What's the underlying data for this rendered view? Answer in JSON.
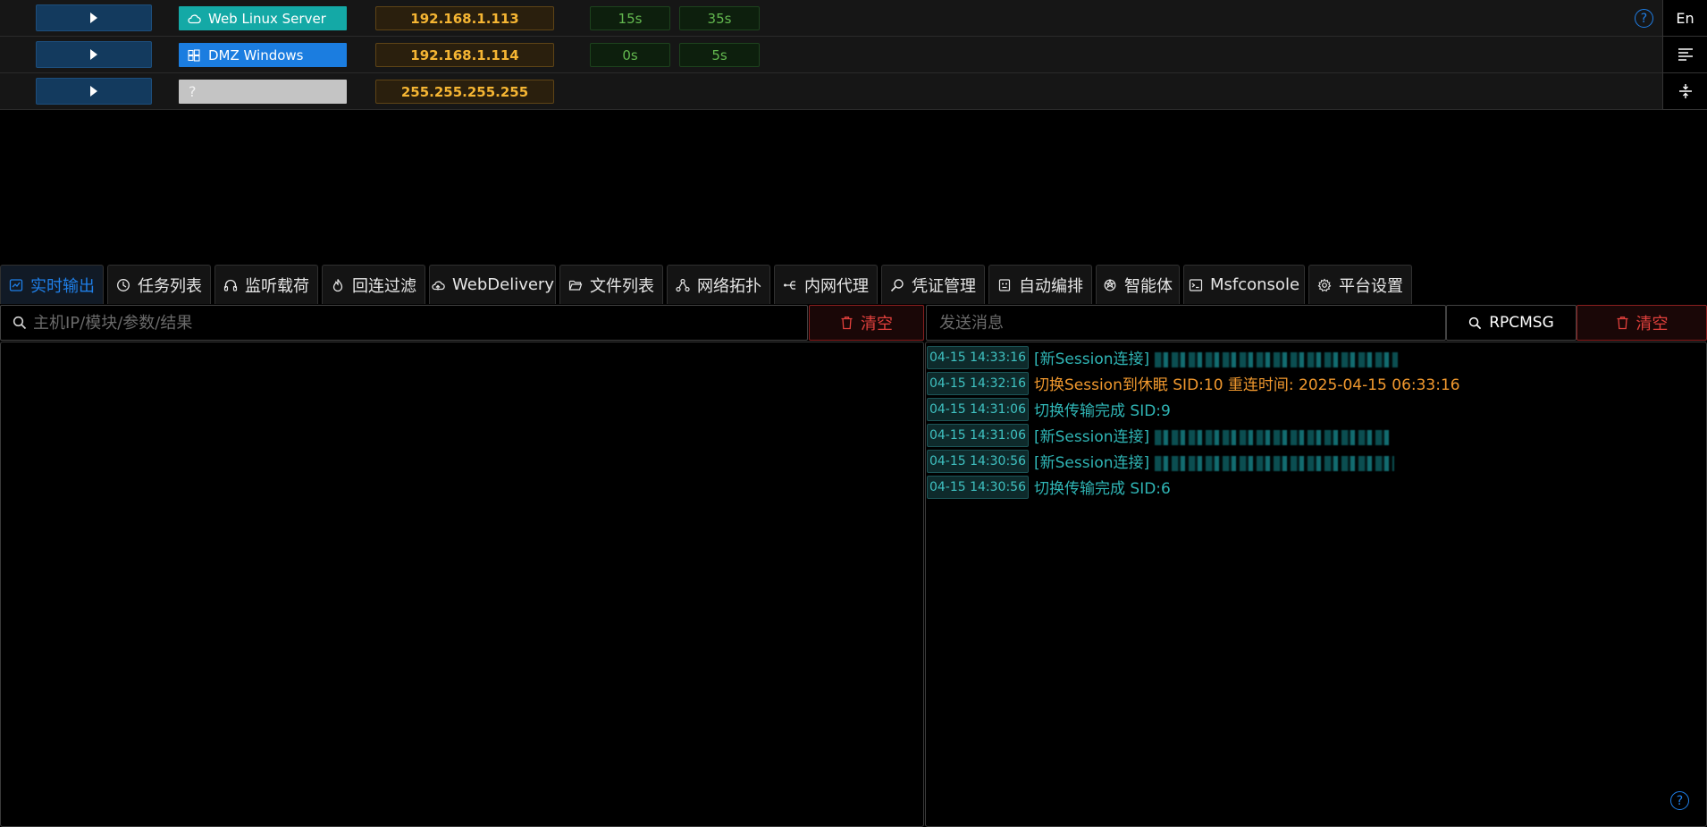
{
  "colors": {
    "accent": "#1f7fe8",
    "linux_tag": "#14a9a6",
    "windows_tag": "#1b7de0",
    "unknown_tag": "#c4c4c4",
    "ip_text": "#f5b533",
    "danger": "#e0403c",
    "log_info": "#2fb5b5",
    "log_warning": "#f0982e"
  },
  "hosts": [
    {
      "name": "Web Linux Server",
      "os_icon": "cloud-icon",
      "ip": "192.168.1.113",
      "time1": "15s",
      "time2": "35s"
    },
    {
      "name": "DMZ Windows",
      "os_icon": "windows-icon",
      "ip": "192.168.1.114",
      "time1": "0s",
      "time2": "5s"
    },
    {
      "name": "",
      "os_icon": "question-icon",
      "os_glyph": "?",
      "ip": "255.255.255.255"
    }
  ],
  "toolbar": {
    "language_label": "En",
    "help_glyph": "?"
  },
  "tabs": [
    {
      "label": "实时输出",
      "icon": "realtime-output-icon",
      "active": true
    },
    {
      "label": "任务列表",
      "icon": "clock-icon"
    },
    {
      "label": "监听载荷",
      "icon": "headphones-icon"
    },
    {
      "label": "回连过滤",
      "icon": "flame-icon"
    },
    {
      "label": "WebDelivery",
      "icon": "cloud-upload-icon"
    },
    {
      "label": "文件列表",
      "icon": "folder-icon"
    },
    {
      "label": "网络拓扑",
      "icon": "topology-icon"
    },
    {
      "label": "内网代理",
      "icon": "proxy-icon"
    },
    {
      "label": "凭证管理",
      "icon": "key-search-icon"
    },
    {
      "label": "自动编排",
      "icon": "robot-icon"
    },
    {
      "label": "智能体",
      "icon": "openai-icon"
    },
    {
      "label": "Msfconsole",
      "icon": "terminal-icon"
    },
    {
      "label": "平台设置",
      "icon": "gear-icon"
    }
  ],
  "output_search": {
    "placeholder": "主机IP/模块/参数/结果",
    "clear_label": "清空"
  },
  "message_bar": {
    "placeholder": "发送消息",
    "rpc_label": "RPCMSG",
    "clear_label": "清空"
  },
  "log_entries": [
    {
      "time": "04-15 14:33:16",
      "text": "[新Session连接]",
      "level": "info",
      "redacted": true
    },
    {
      "time": "04-15 14:32:16",
      "text": "切换Session到休眠 SID:10 重连时间: 2025-04-15 06:33:16",
      "level": "warning"
    },
    {
      "time": "04-15 14:31:06",
      "text": "切换传输完成 SID:9",
      "level": "info"
    },
    {
      "time": "04-15 14:31:06",
      "text": "[新Session连接]",
      "level": "info",
      "redacted": true
    },
    {
      "time": "04-15 14:30:56",
      "text": "[新Session连接]",
      "level": "info",
      "redacted": true
    },
    {
      "time": "04-15 14:30:56",
      "text": "切换传输完成 SID:6",
      "level": "info"
    }
  ]
}
